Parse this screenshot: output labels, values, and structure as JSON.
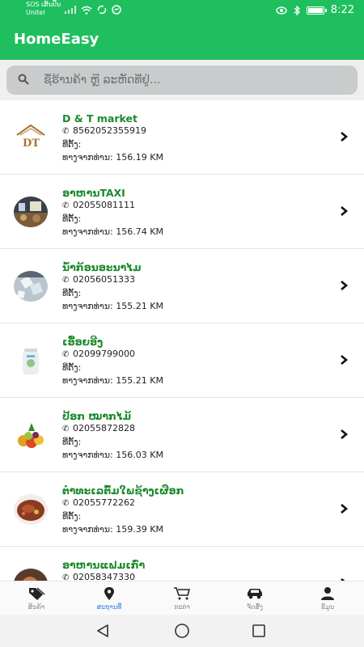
{
  "status_bar": {
    "carrier_line1": "SOS ເສັ້ນປົ້ນ",
    "carrier_line2": "Unitel",
    "time": "8:22"
  },
  "app": {
    "title": "HomeEasy"
  },
  "search": {
    "placeholder": "ຊື່ຮ້ານຄ້າ ຫຼື ລະຫັດທີ່ຢູ່..."
  },
  "labels": {
    "location": "ທີ່ຕັ້ງ:"
  },
  "stores": [
    {
      "name": "D & T market",
      "phone": "8562052355919",
      "distance": "ທາງຈາກທ່ານ: 156.19 KM"
    },
    {
      "name": "ອາຫານTAXI",
      "phone": "02055081111",
      "distance": "ທາງຈາກທ່ານ: 156.74 KM"
    },
    {
      "name": "ນ້ຳກ້ອນອະນາໄມ",
      "phone": "02056051333",
      "distance": "ທາງຈາກທ່ານ: 155.21 KM"
    },
    {
      "name": "ເອື້ອຍອີງ",
      "phone": "02099799000",
      "distance": "ທາງຈາກທ່ານ: 155.21 KM"
    },
    {
      "name": "ປ້ອກ ໝາກໄມ້",
      "phone": "02055872828",
      "distance": "ທາງຈາກທ່ານ: 156.03 KM"
    },
    {
      "name": "ຕຳທະເລຕົ້ມໃພຊ້າງເຜືອກ",
      "phone": "02055772262",
      "distance": "ທາງຈາກທ່ານ: 159.39 KM"
    },
    {
      "name": "ອາຫານແຟມເກົ່າ",
      "phone": "02058347330",
      "distance": ""
    }
  ],
  "bottom_nav": [
    {
      "label": "ສິນຄ້າ",
      "icon": "tags-icon",
      "active": false
    },
    {
      "label": "ສະຖານທີ່",
      "icon": "location-pin-icon",
      "active": true
    },
    {
      "label": "ກະຕ່າ",
      "icon": "cart-icon",
      "active": false
    },
    {
      "label": "ຈັດສົ່ງ",
      "icon": "car-icon",
      "active": false
    },
    {
      "label": "ຂໍ້ມູນ",
      "icon": "user-icon",
      "active": false
    }
  ],
  "colors": {
    "primary": "#1fbf5f",
    "store_name": "#1a8a2a",
    "active_nav": "#2d7fd8"
  }
}
